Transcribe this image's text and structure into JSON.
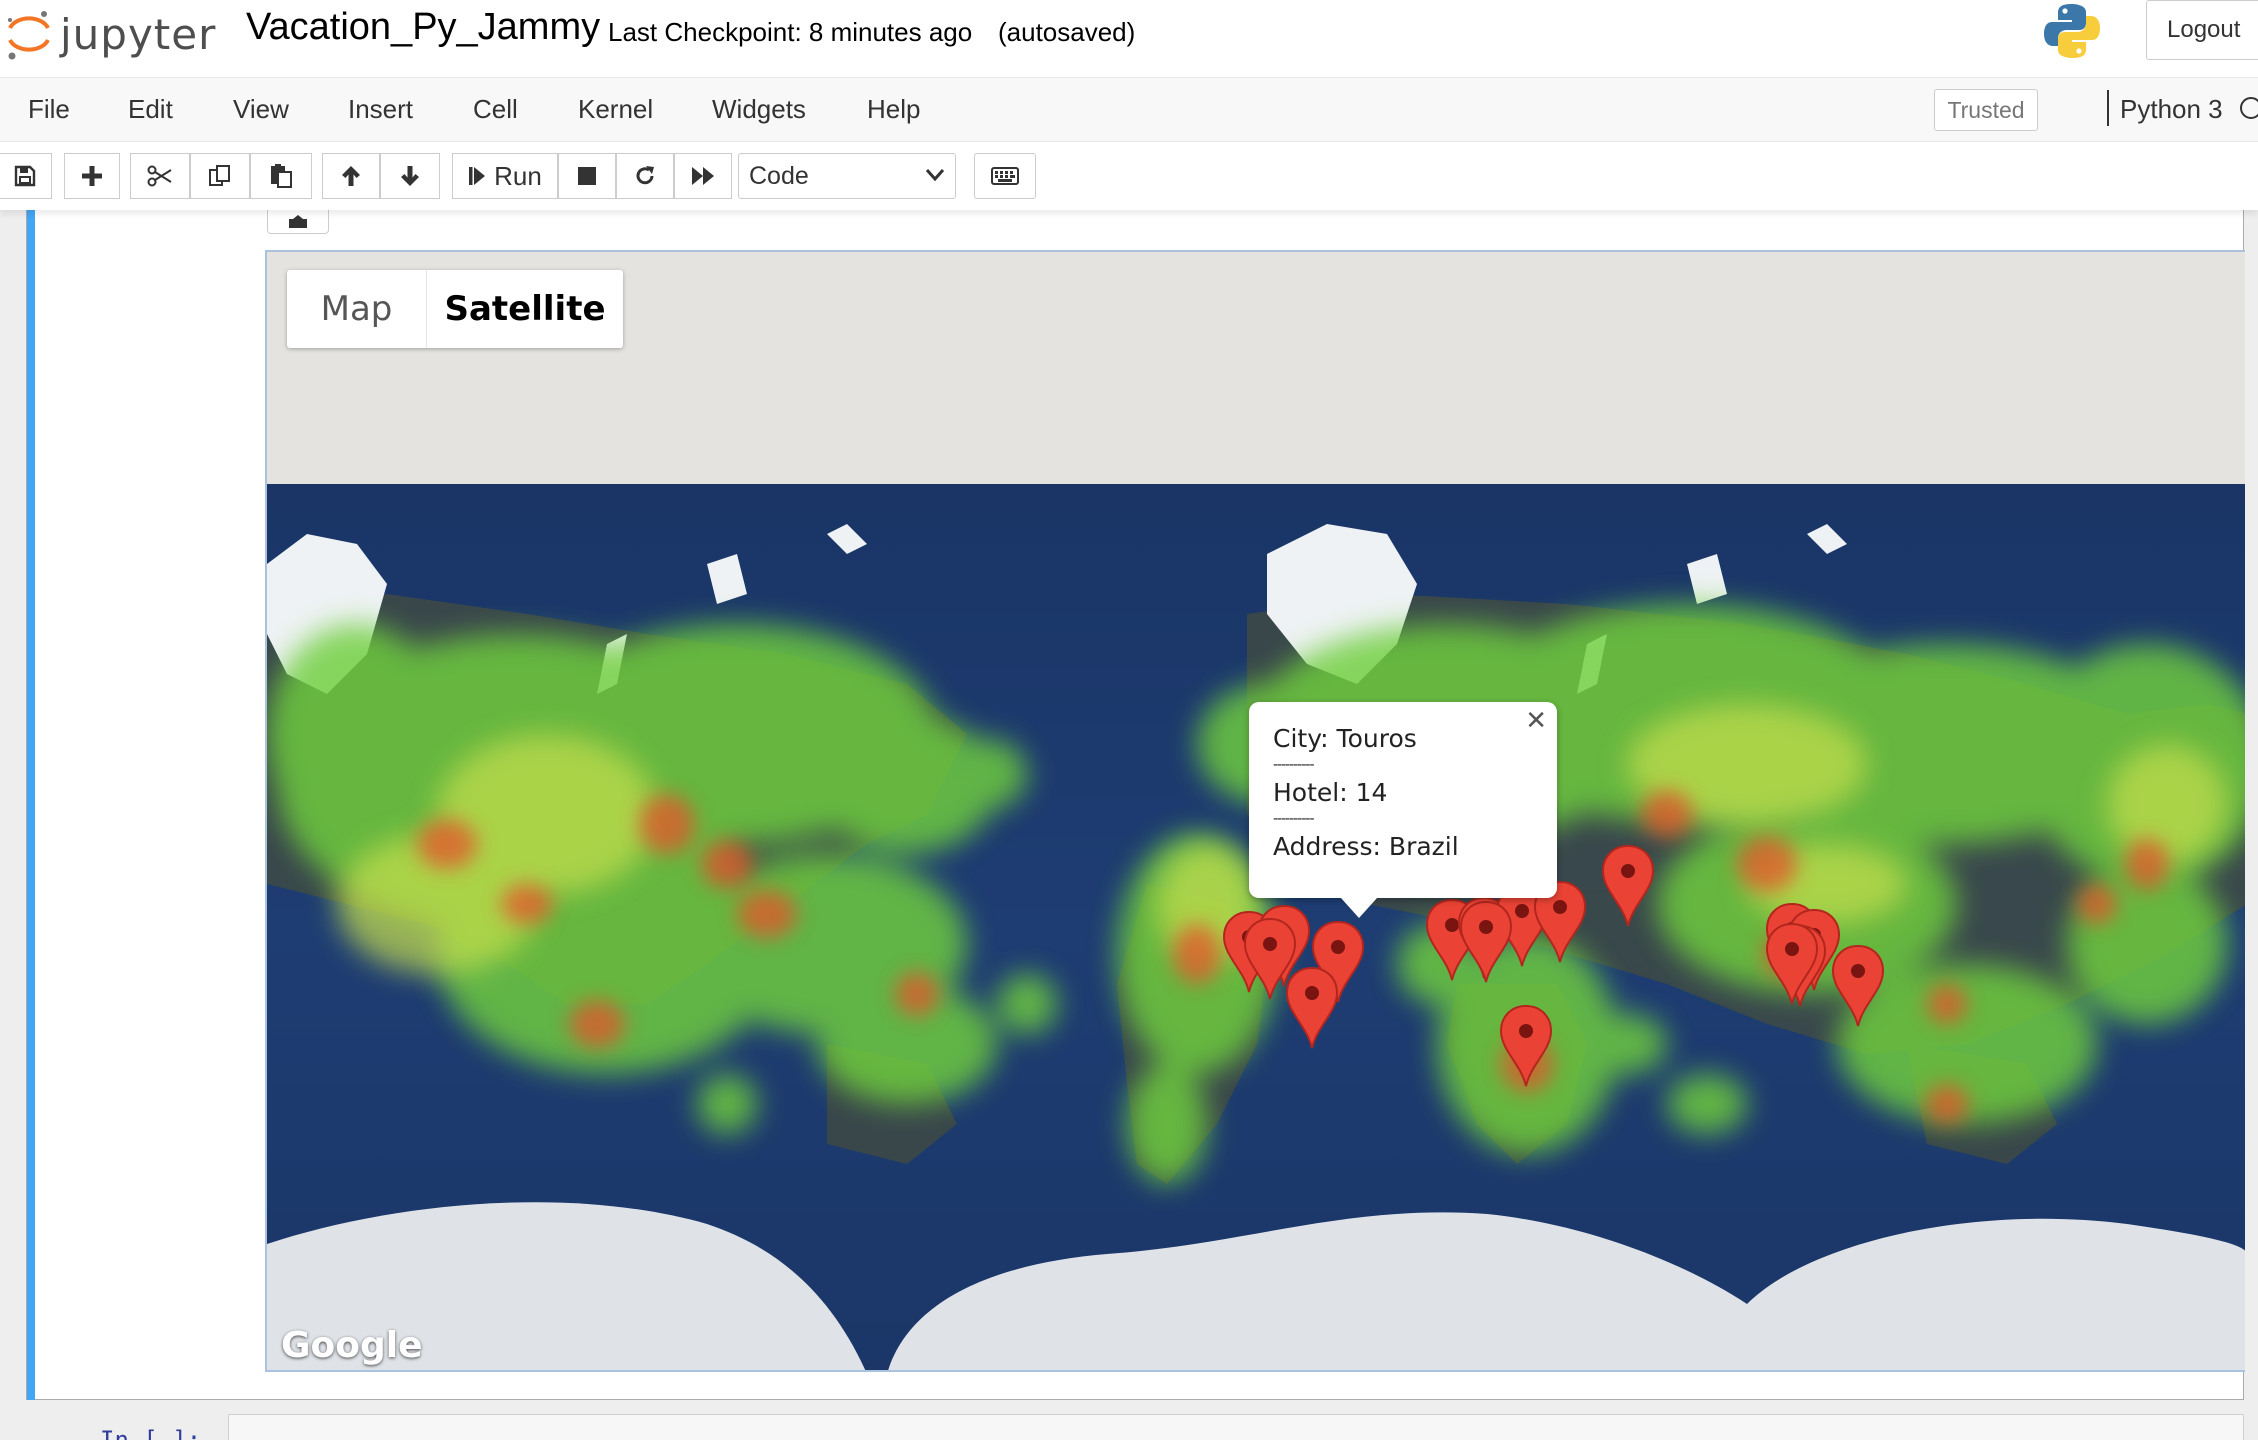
{
  "header": {
    "logo_text": "jupyter",
    "notebook_name": "Vacation_Py_Jammy",
    "checkpoint": "Last Checkpoint: 8 minutes ago",
    "autosave": "(autosaved)",
    "logout_label": "Logout"
  },
  "menubar": {
    "items": [
      "File",
      "Edit",
      "View",
      "Insert",
      "Cell",
      "Kernel",
      "Widgets",
      "Help"
    ],
    "trusted_label": "Trusted",
    "kernel_name": "Python 3"
  },
  "toolbar": {
    "run_label": "Run",
    "cell_type": "Code",
    "icons": [
      "save-icon",
      "plus-icon",
      "scissors-icon",
      "copy-icon",
      "paste-icon",
      "arrow-up-icon",
      "arrow-down-icon",
      "run-icon",
      "stop-icon",
      "restart-icon",
      "fast-forward-icon",
      "keyboard-icon"
    ]
  },
  "map": {
    "type_buttons": [
      "Map",
      "Satellite"
    ],
    "selected_type": "Satellite",
    "attribution": "Google",
    "info_window": {
      "city_line": "City: Touros",
      "separator": "----------",
      "hotel_line": "Hotel: 14",
      "address_line": "Address: Brazil"
    },
    "marker_color": "#ea4335"
  },
  "next_cell": {
    "prompt": "In [ ]:"
  },
  "colors": {
    "accent_cell_bar": "#42a5f5",
    "ocean": "#1d3a6e",
    "heat_low": "#7fd24a",
    "heat_high": "#d83b1f"
  }
}
